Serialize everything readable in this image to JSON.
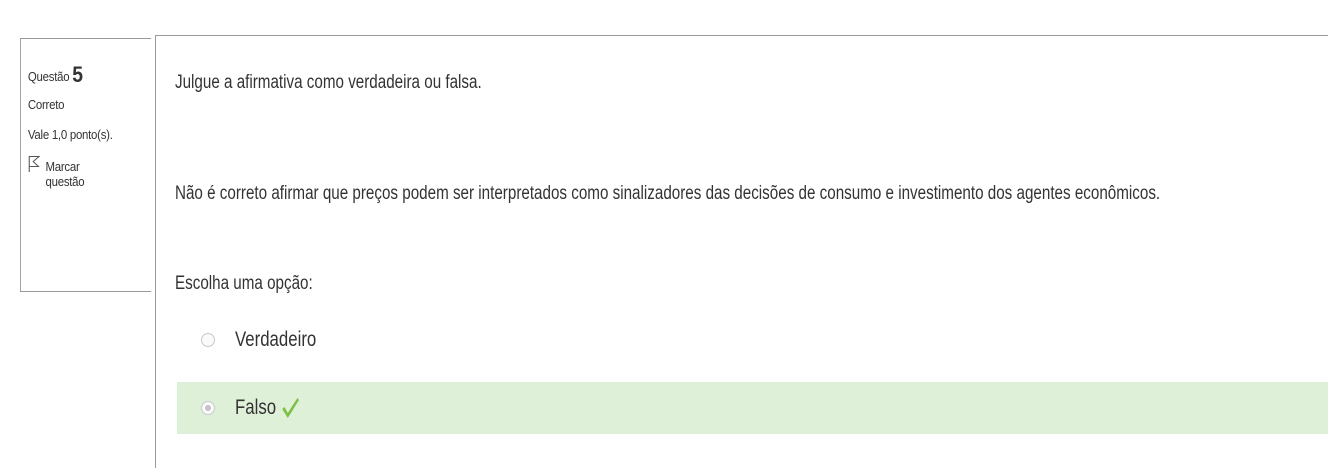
{
  "question_info": {
    "label": "Questão",
    "number": "5",
    "state": "Correto",
    "grade": "Vale 1,0 ponto(s).",
    "flag_line1": "Marcar",
    "flag_line2": "questão"
  },
  "question": {
    "instruction": "Julgue a afirmativa como verdadeira ou falsa.",
    "statement": "Não é correto afirmar que preços podem ser interpretados como sinalizadores das decisões de consumo e investimento dos agentes econômicos.",
    "prompt": "Escolha uma opção:",
    "options": [
      {
        "label": "Verdadeiro",
        "selected": false
      },
      {
        "label": "Falso",
        "selected": true,
        "correct": true
      }
    ]
  },
  "colors": {
    "correct_background": "#dff0d8",
    "check_green": "#7cc044",
    "border": "#999999"
  },
  "icons": [
    "flag-icon",
    "radio-icon",
    "check-icon"
  ]
}
